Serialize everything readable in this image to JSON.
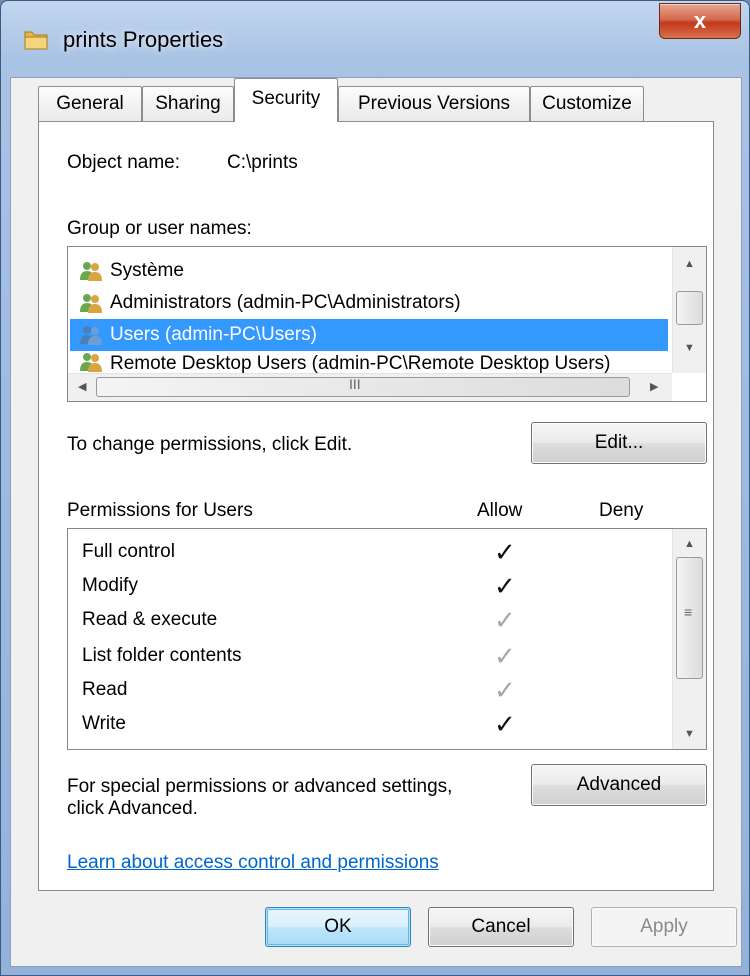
{
  "window": {
    "title": "prints Properties",
    "close_label": "x"
  },
  "tabs": [
    {
      "label": "General",
      "active": false
    },
    {
      "label": "Sharing",
      "active": false
    },
    {
      "label": "Security",
      "active": true
    },
    {
      "label": "Previous Versions",
      "active": false
    },
    {
      "label": "Customize",
      "active": false
    }
  ],
  "security": {
    "object_name_label": "Object name:",
    "object_name_value": "C:\\prints",
    "group_label": "Group or user names:",
    "users": [
      {
        "name": "Système",
        "selected": false
      },
      {
        "name": "Administrators (admin-PC\\Administrators)",
        "selected": false
      },
      {
        "name": "Users (admin-PC\\Users)",
        "selected": true
      },
      {
        "name": "Remote Desktop Users (admin-PC\\Remote Desktop Users)",
        "selected": false
      }
    ],
    "hscroll_grip": "III",
    "change_hint": "To change permissions, click Edit.",
    "edit_button": "Edit...",
    "permissions_header": "Permissions for Users",
    "allow_header": "Allow",
    "deny_header": "Deny",
    "permissions": [
      {
        "name": "Full control",
        "allow": "explicit",
        "deny": "none"
      },
      {
        "name": "Modify",
        "allow": "explicit",
        "deny": "none"
      },
      {
        "name": "Read & execute",
        "allow": "inherited",
        "deny": "none"
      },
      {
        "name": "List folder contents",
        "allow": "inherited",
        "deny": "none"
      },
      {
        "name": "Read",
        "allow": "inherited",
        "deny": "none"
      },
      {
        "name": "Write",
        "allow": "explicit",
        "deny": "none"
      }
    ],
    "special_hint_line1": "For special permissions or advanced settings,",
    "special_hint_line2": "click Advanced.",
    "advanced_button": "Advanced",
    "learn_link": "Learn about access control and permissions"
  },
  "footer": {
    "ok": "OK",
    "cancel": "Cancel",
    "apply": "Apply"
  },
  "icons": {
    "folder": "folder-icon",
    "user_group": "user-group-icon",
    "check": "checkmark-icon"
  },
  "colors": {
    "selection": "#3399ff",
    "link": "#0066cc",
    "inherited_check": "#a8a8a8"
  }
}
